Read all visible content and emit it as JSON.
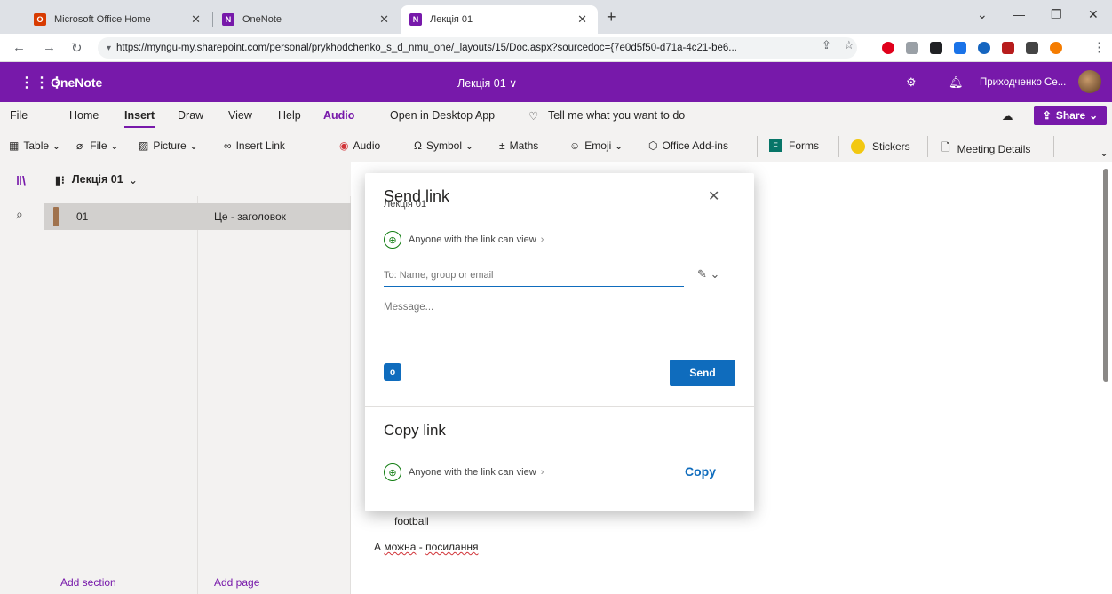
{
  "browser": {
    "tabs": [
      {
        "title": "Microsoft Office Home",
        "favicon_color": "#d83b01",
        "favicon_glyph": "O"
      },
      {
        "title": "OneNote",
        "favicon_color": "#7719aa",
        "favicon_glyph": "N"
      },
      {
        "title": "Лекція 01",
        "favicon_color": "#7719aa",
        "favicon_glyph": "N"
      }
    ],
    "url": "https://myngu-my.sharepoint.com/personal/prykhodchenko_s_d_nmu_one/_layouts/15/Doc.aspx?sourcedoc={7e0d5f50-d71a-4c21-be6..."
  },
  "app": {
    "name": "OneNote",
    "doc_title": "Лекція 01 ∨",
    "user_name": "Приходченко Се...",
    "accent": "#7719aa"
  },
  "ribbon": {
    "tabs": [
      "File",
      "Home",
      "Insert",
      "Draw",
      "View",
      "Help",
      "Audio",
      "Open in Desktop App"
    ],
    "tell_me": "Tell me what you want to do",
    "share": "Share",
    "tools": {
      "table": "Table",
      "file": "File",
      "picture": "Picture",
      "insert_link": "Insert Link",
      "audio": "Audio",
      "symbol": "Symbol",
      "math": "Maths",
      "emoji": "Emoji",
      "office_addins": "Office Add-ins",
      "forms": "Forms",
      "stickers": "Stickers",
      "meeting_details": "Meeting Details"
    }
  },
  "notebook": {
    "title": "Лекція 01",
    "section": "01",
    "page": "Це - заголовок",
    "add_section": "Add section",
    "add_page": "Add page"
  },
  "canvas": {
    "line1": "football",
    "line2_a": "А ",
    "line2_b": "можна",
    "line2_c": " - ",
    "line2_d": "посилання"
  },
  "dialog": {
    "title": "Send link",
    "subtitle": "Лекція 01",
    "permission": "Anyone with the link can view",
    "to_placeholder": "To: Name, group or email",
    "message_placeholder": "Message...",
    "send": "Send",
    "copy_title": "Copy link",
    "copy_permission": "Anyone with the link can view",
    "copy": "Copy"
  }
}
